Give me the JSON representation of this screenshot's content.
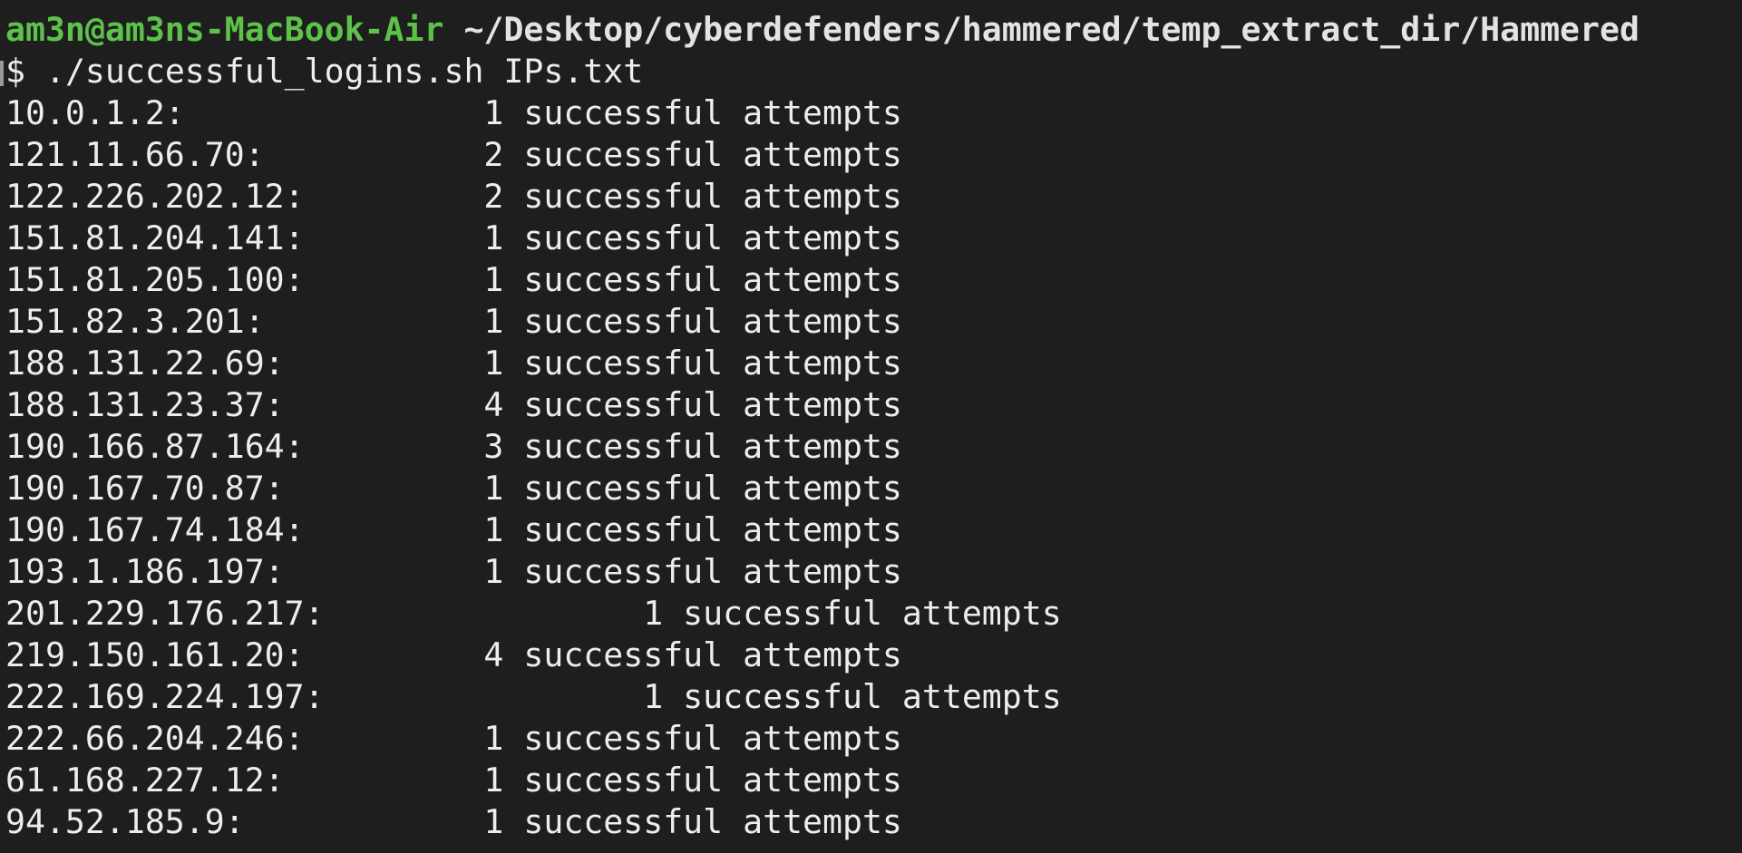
{
  "prompt": {
    "user_host": "am3n@am3ns-MacBook-Air",
    "path": "~/Desktop/cyberdefenders/hammered/temp_extract_dir/Hammered",
    "symbol": "$",
    "command": "./successful_logins.sh IPs.txt"
  },
  "suffix": "successful attempts",
  "rows": [
    {
      "ip": "10.0.1.2:",
      "count": "1"
    },
    {
      "ip": "121.11.66.70:",
      "count": "2"
    },
    {
      "ip": "122.226.202.12:",
      "count": "2"
    },
    {
      "ip": "151.81.204.141:",
      "count": "1"
    },
    {
      "ip": "151.81.205.100:",
      "count": "1"
    },
    {
      "ip": "151.82.3.201:",
      "count": "1"
    },
    {
      "ip": "188.131.22.69:",
      "count": "1"
    },
    {
      "ip": "188.131.23.37:",
      "count": "4"
    },
    {
      "ip": "190.166.87.164:",
      "count": "3"
    },
    {
      "ip": "190.167.70.87:",
      "count": "1"
    },
    {
      "ip": "190.167.74.184:",
      "count": "1"
    },
    {
      "ip": "193.1.186.197:",
      "count": "1"
    },
    {
      "ip": "201.229.176.217:",
      "count": "1"
    },
    {
      "ip": "219.150.161.20:",
      "count": "4"
    },
    {
      "ip": "222.169.224.197:",
      "count": "1"
    },
    {
      "ip": "222.66.204.246:",
      "count": "1"
    },
    {
      "ip": "61.168.227.12:",
      "count": "1"
    },
    {
      "ip": "94.52.185.9:",
      "count": "1"
    }
  ]
}
